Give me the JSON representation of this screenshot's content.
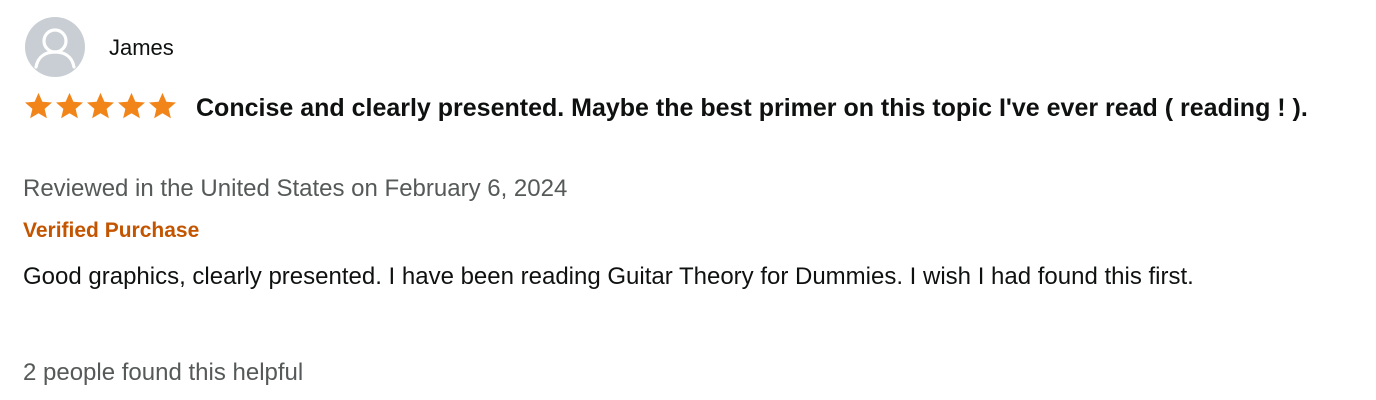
{
  "reviewer": {
    "name": "James",
    "avatar_icon": "user-silhouette-icon"
  },
  "review": {
    "rating": 5,
    "rating_max": 5,
    "star_color": "#f1851a",
    "title": "Concise and clearly presented. Maybe the best primer on this topic I've ever read ( reading ! ).",
    "meta": "Reviewed in the United States on February 6, 2024",
    "badge": "Verified Purchase",
    "badge_color": "#c45500",
    "body": "Good graphics, clearly presented. I have been reading Guitar Theory for Dummies. I wish I had found this first.",
    "helpful": "2 people found this helpful"
  }
}
